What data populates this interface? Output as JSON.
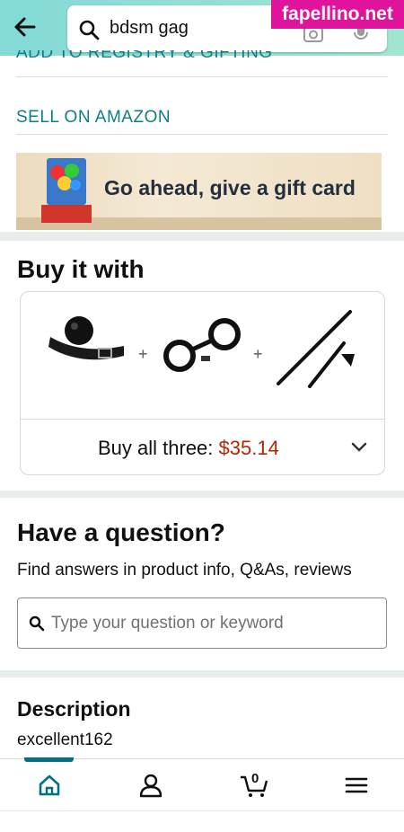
{
  "search": {
    "query": "bdsm gag"
  },
  "watermark": "fapellino.net",
  "links": {
    "registry": "ADD TO REGISTRY & GIFTING",
    "sell": "SELL ON AMAZON"
  },
  "banner": {
    "text": "Go ahead, give a gift card"
  },
  "buy_with": {
    "title": "Buy it with",
    "plus": "+",
    "buy_all_label": "Buy all three: ",
    "price": "$35.14"
  },
  "question": {
    "title": "Have a question?",
    "subtitle": "Find answers in product info, Q&As, reviews",
    "placeholder": "Type your question or keyword"
  },
  "description": {
    "title": "Description",
    "text": "excellent162"
  },
  "nav": {
    "cart_count": "0"
  },
  "colors": {
    "teal_link": "#0e7f86",
    "price": "#B12704",
    "topbar": "#83DAD6",
    "active_nav": "#007185"
  },
  "icons": [
    "back-arrow-icon",
    "search-icon",
    "camera-icon",
    "mic-icon",
    "chevron-down-icon",
    "home-icon",
    "account-icon",
    "cart-icon",
    "menu-icon"
  ]
}
